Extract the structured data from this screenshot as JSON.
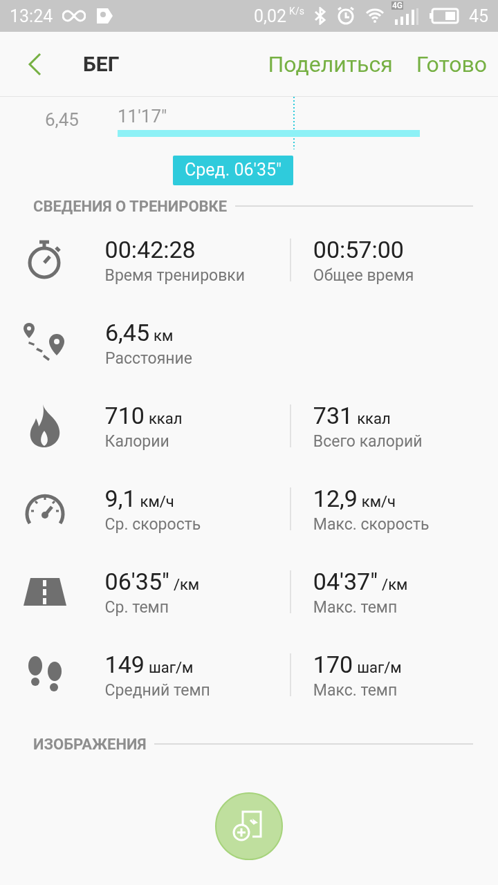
{
  "status_bar": {
    "time": "13:24",
    "network_speed": "0,02",
    "speed_unit": "K/s",
    "network": "4G",
    "battery": "45"
  },
  "header": {
    "title": "БЕГ",
    "actions": [
      "Поделиться",
      "Готово"
    ]
  },
  "pace_chart": {
    "row_label": "6,45",
    "bar_label": "11'17\"",
    "average_label": "Сред. 06'35\""
  },
  "workout_section": {
    "title": "СВЕДЕНИЯ О ТРЕНИРОВКЕ",
    "rows": [
      {
        "kind": "stopwatch",
        "left": {
          "value": "00:42:28",
          "label": "Время тренировки"
        },
        "right": {
          "value": "00:57:00",
          "label": "Общее время"
        }
      },
      {
        "kind": "route",
        "left": {
          "value": "6,45",
          "unit": "км",
          "label": "Расстояние"
        }
      },
      {
        "kind": "flame",
        "left": {
          "value": "710",
          "unit": "ккал",
          "label": "Калории"
        },
        "right": {
          "value": "731",
          "unit": "ккал",
          "label": "Всего калорий"
        }
      },
      {
        "kind": "speedometer",
        "left": {
          "value": "9,1",
          "unit": "км/ч",
          "label": "Ср. скорость"
        },
        "right": {
          "value": "12,9",
          "unit": "км/ч",
          "label": "Макс. скорость"
        }
      },
      {
        "kind": "road",
        "left": {
          "value": "06'35\"",
          "unit": "/км",
          "label": "Ср. темп"
        },
        "right": {
          "value": "04'37\"",
          "unit": "/км",
          "label": "Макс. темп"
        }
      },
      {
        "kind": "footprints",
        "left": {
          "value": "149",
          "unit": "шаг/м",
          "label": "Средний темп"
        },
        "right": {
          "value": "170",
          "unit": "шаг/м",
          "label": "Макс. темп"
        }
      }
    ]
  },
  "images_section": {
    "title": "ИЗОБРАЖЕНИЯ"
  }
}
